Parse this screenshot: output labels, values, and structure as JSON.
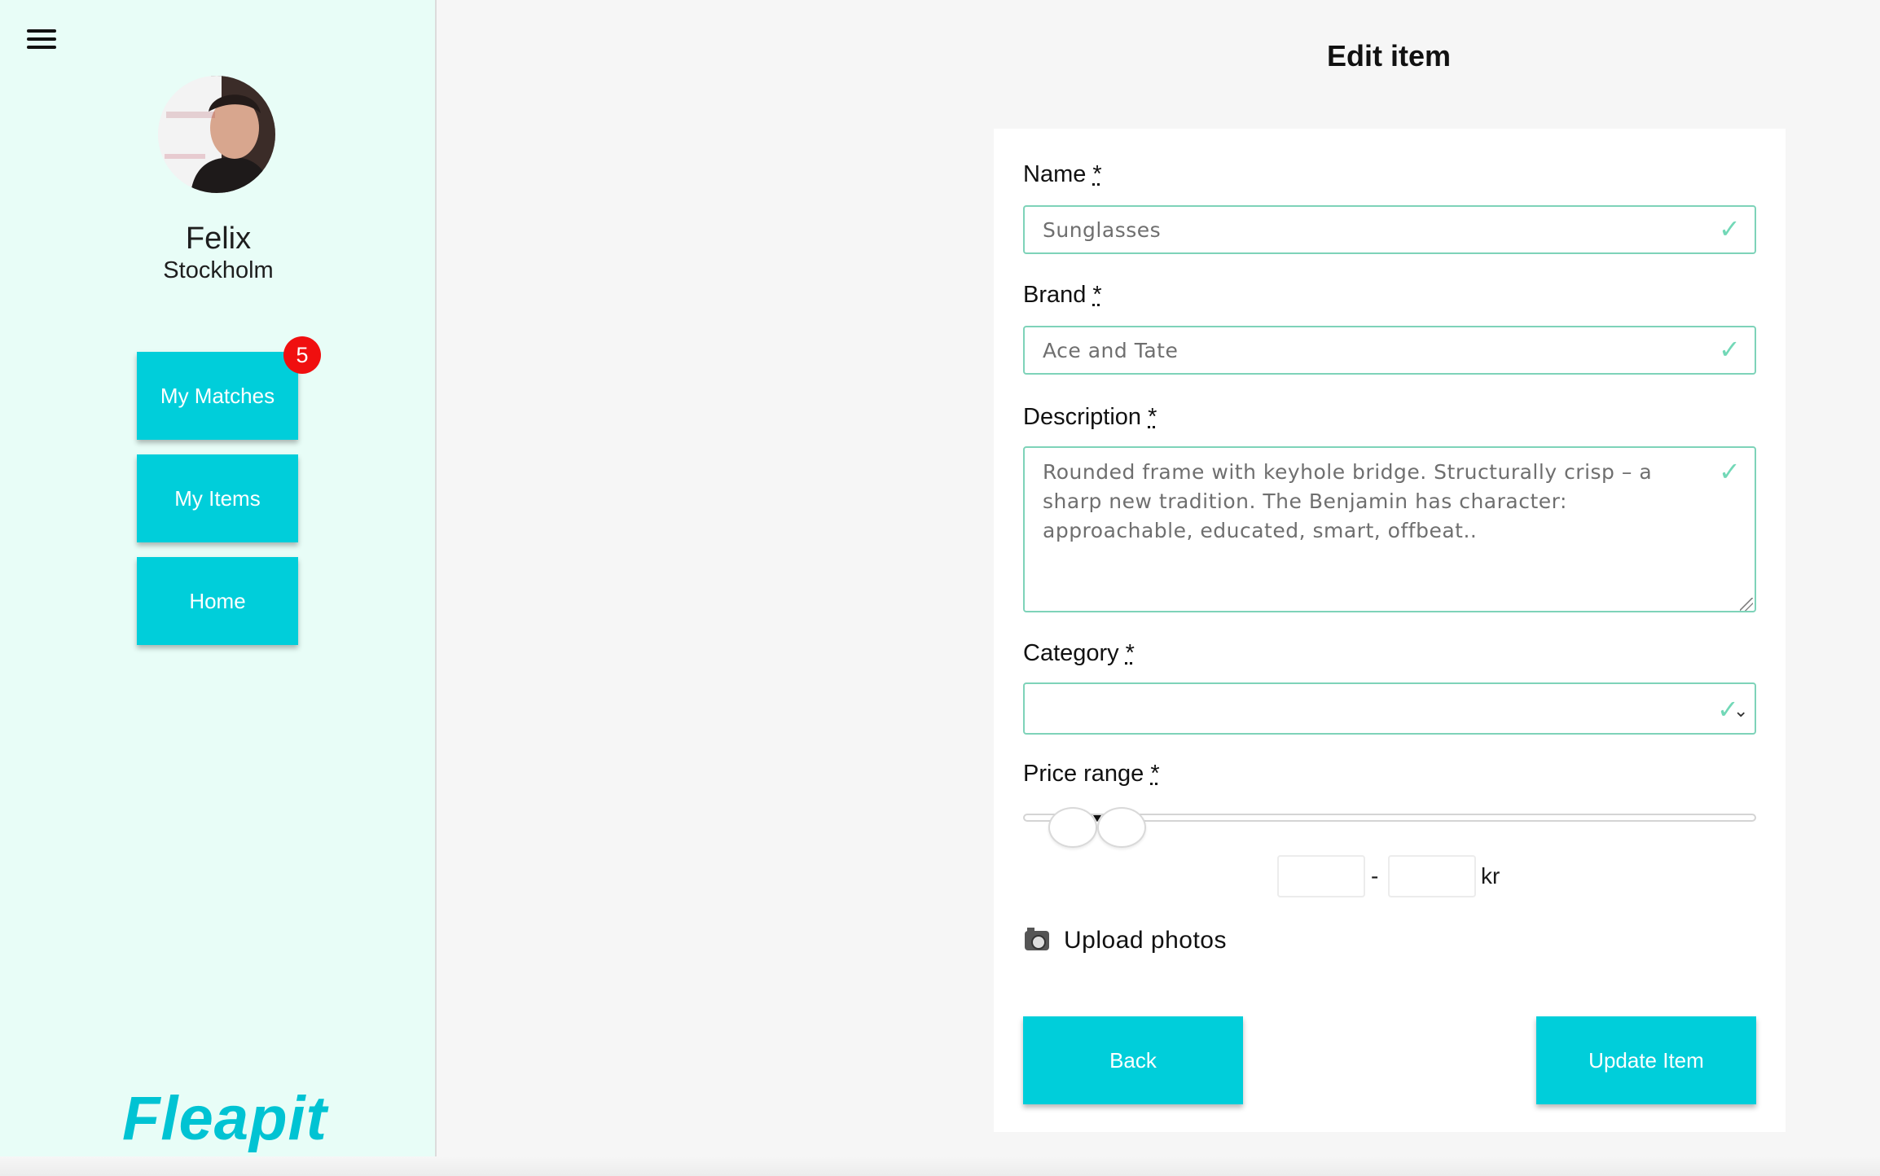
{
  "sidebar": {
    "user": {
      "name": "Felix",
      "city": "Stockholm"
    },
    "nav": [
      {
        "label": "My Matches",
        "badge": "5"
      },
      {
        "label": "My Items"
      },
      {
        "label": "Home"
      }
    ],
    "logo_text": "Fleapit"
  },
  "main": {
    "title": "Edit item",
    "required_marker": "*",
    "fields": {
      "name": {
        "label": "Name",
        "value": "Sunglasses"
      },
      "brand": {
        "label": "Brand",
        "value": "Ace and Tate"
      },
      "description": {
        "label": "Description",
        "value": "Rounded frame with keyhole bridge. Structurally crisp – a sharp new tradition. The Benjamin has character: approachable, educated, smart, offbeat.."
      },
      "category": {
        "label": "Category",
        "value": ""
      },
      "price_range": {
        "label": "Price range",
        "min": "",
        "max": "",
        "separator": "-",
        "unit": "kr"
      }
    },
    "upload_label": "Upload photos",
    "buttons": {
      "back": "Back",
      "update": "Update Item"
    }
  },
  "colors": {
    "accent": "#00ceda",
    "sidebar_bg": "#e8fdf7",
    "valid_border": "#7ed3b9",
    "badge": "#f00f0f"
  },
  "icons": [
    "menu-icon",
    "trash-icon",
    "check-icon",
    "chevron-down-icon",
    "camera-icon"
  ]
}
